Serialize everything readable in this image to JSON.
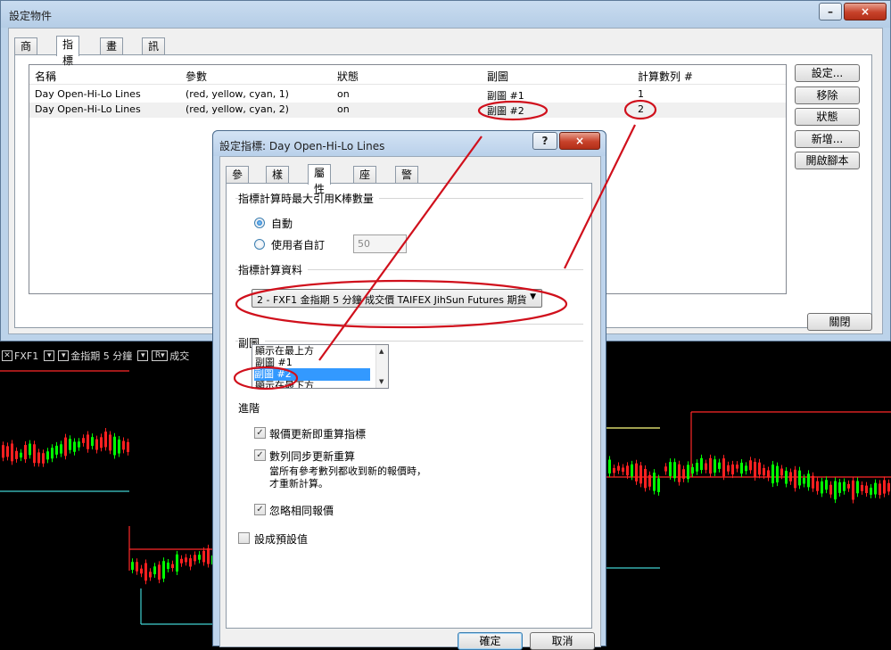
{
  "outer_window": {
    "title": "設定物件",
    "minimize": "–",
    "close": "×",
    "tabs": [
      {
        "label": "商品"
      },
      {
        "label": "指標"
      },
      {
        "label": "畫線"
      },
      {
        "label": "訊號"
      }
    ],
    "columns": [
      "名稱",
      "參數",
      "狀態",
      "副圖",
      "計算數列 #"
    ],
    "rows": [
      {
        "name": "Day Open-Hi-Lo Lines",
        "params": "(red, yellow, cyan, 1)",
        "status": "on",
        "subchart": "副圖 #1",
        "series": "1"
      },
      {
        "name": "Day Open-Hi-Lo Lines",
        "params": "(red, yellow, cyan, 2)",
        "status": "on",
        "subchart": "副圖 #2",
        "series": "2"
      }
    ],
    "buttons": {
      "settings": "設定...",
      "remove": "移除",
      "status": "狀態",
      "add": "新增...",
      "open_script": "開啟腳本",
      "close": "關閉"
    }
  },
  "chart_strip": {
    "close_box": "✕",
    "symbol": "FXF1",
    "drop": "▾",
    "desc": "金指期 5 分鐘",
    "r_box": "R▾",
    "price_type": "成交"
  },
  "dialog": {
    "title": "設定指標: Day Open-Hi-Lo Lines",
    "help": "?",
    "close": "×",
    "tabs": [
      {
        "label": "參數"
      },
      {
        "label": "樣式"
      },
      {
        "label": "屬性"
      },
      {
        "label": "座標"
      },
      {
        "label": "警示"
      }
    ],
    "max_bars_section": "指標計算時最大引用K棒數量",
    "auto_label": "自動",
    "user_label": "使用者自訂",
    "user_value": "50",
    "data_section": "指標計算資料",
    "data_combo": "2 - FXF1 金指期 5 分鐘 成交價 TAIFEX JihSun Futures 期貨",
    "combo_arrow": "▼",
    "subchart_section": "副圖",
    "subchart_items": [
      "顯示在最上方",
      "副圖 #1",
      "副圖 #2",
      "顯示在最下方"
    ],
    "advanced_section": "進階",
    "check_update": "報價更新即重算指標",
    "check_sync": "數列同步更新重算",
    "sync_note_1": "當所有參考數列都收到新的報價時，",
    "sync_note_2": "才重新計算。",
    "check_ignore": "忽略相同報價",
    "check_default": "設成預設值",
    "check_mark": "✓",
    "ok": "確定",
    "cancel": "取消"
  },
  "colors": {
    "annotation": "#d0101c",
    "chart_up": "#00ff00",
    "chart_down": "#ff2020",
    "line_red": "#ff2828",
    "line_yellow": "#ffff80",
    "line_cyan": "#40d0d0"
  }
}
